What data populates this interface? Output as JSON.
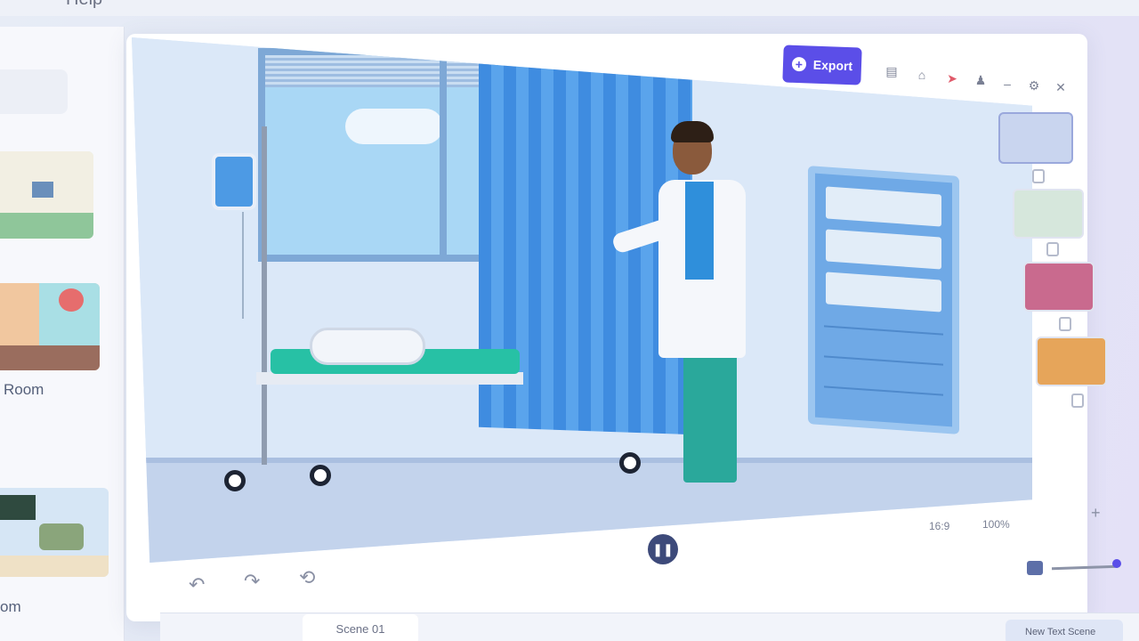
{
  "menu": {
    "help": "Help"
  },
  "left_panel": {
    "thumb_labels": [
      "Room",
      "om"
    ]
  },
  "toolbar": {
    "export_label": "Export",
    "icons": [
      "copy-icon",
      "home-icon",
      "cursor-icon",
      "user-icon",
      "minimize-icon",
      "settings-icon",
      "close-icon"
    ]
  },
  "canvas": {
    "aspect_ratio": "16:9",
    "zoom": "100%"
  },
  "controls": {
    "pause_icon": "pause-icon",
    "undo_icon": "undo-icon",
    "redo_icon": "redo-icon",
    "replay_icon": "replay-icon"
  },
  "timeline": {
    "scene_tab": "Scene 01",
    "tag": "New Text Scene"
  },
  "colors": {
    "accent": "#5b4ee8",
    "curtain": "#3f8ce0",
    "bed": "#27c1a5"
  }
}
